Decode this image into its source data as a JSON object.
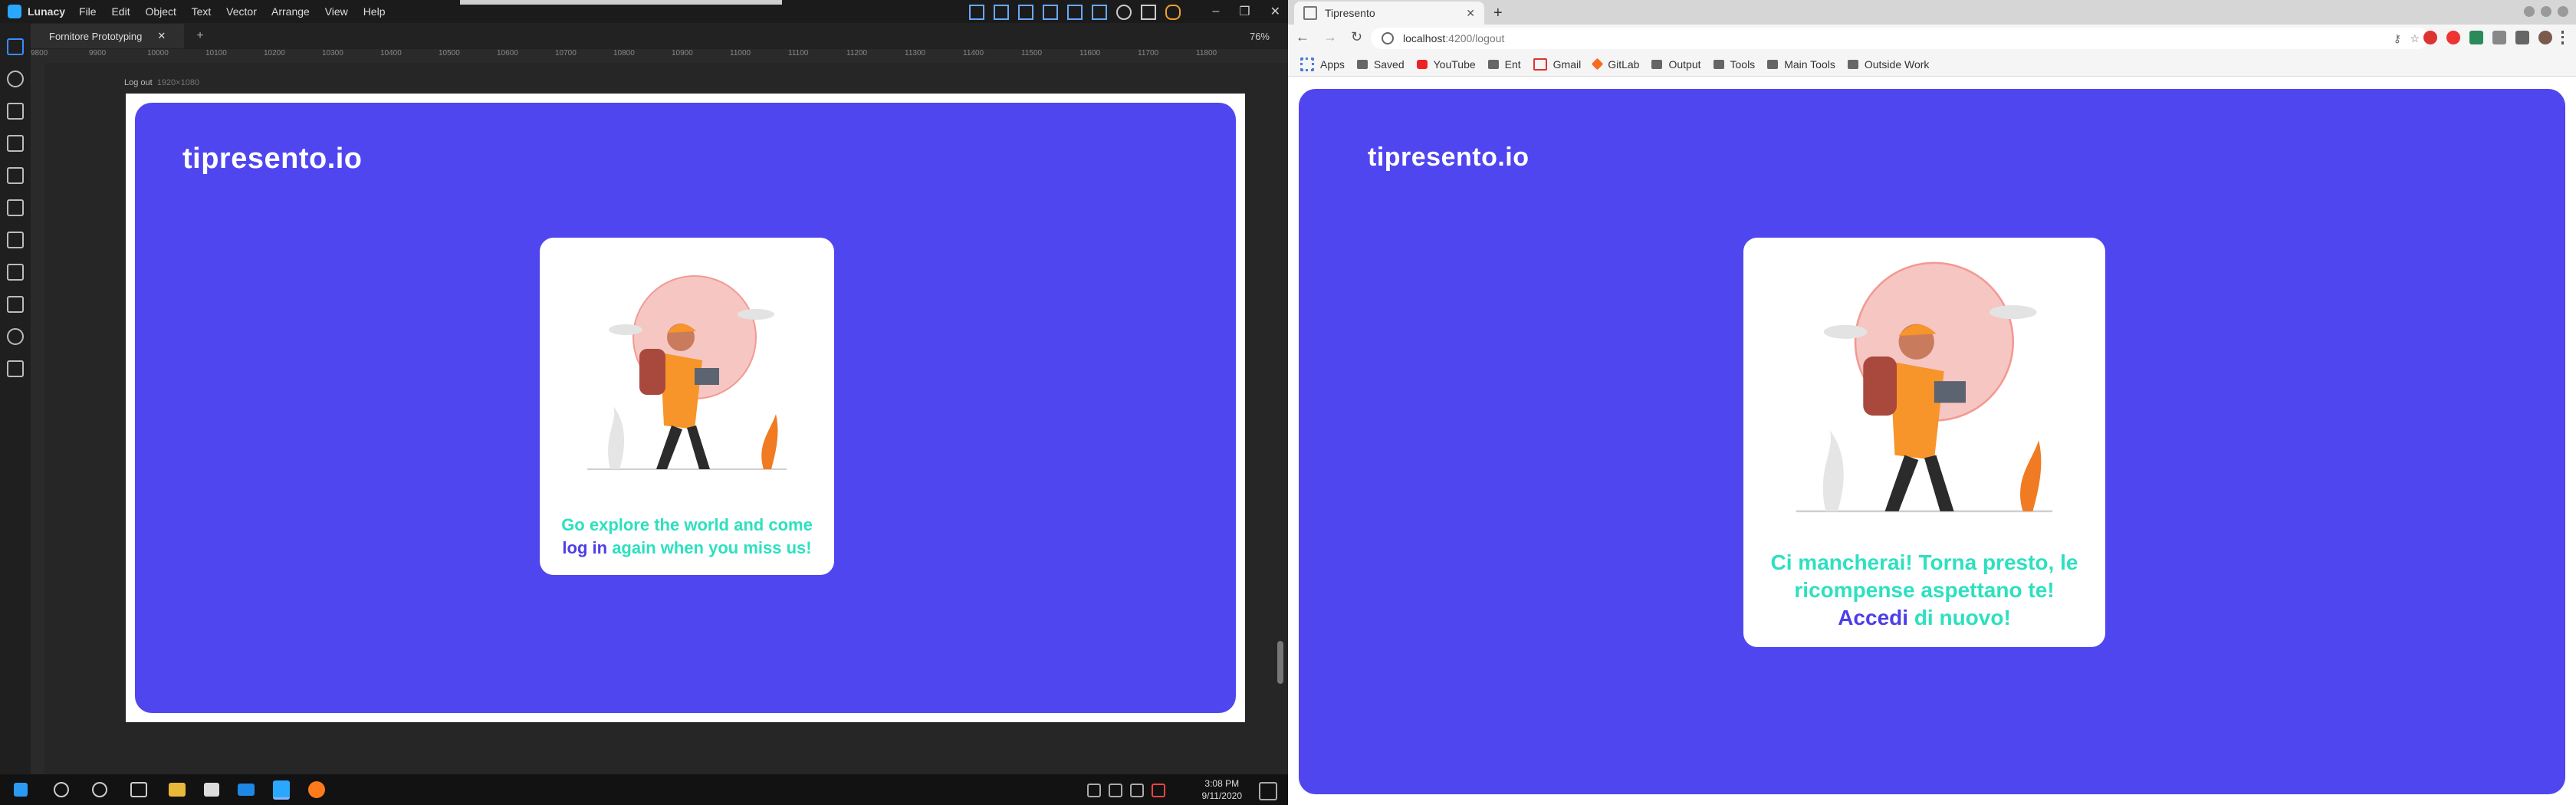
{
  "lunacy": {
    "app_name": "Lunacy",
    "menu": [
      "File",
      "Edit",
      "Object",
      "Text",
      "Vector",
      "Arrange",
      "View",
      "Help"
    ],
    "document_tab": "Fornitore Prototyping",
    "zoom": "76%",
    "ruler_ticks": [
      "9800",
      "9900",
      "10000",
      "10100",
      "10200",
      "10300",
      "10400",
      "10500",
      "10600",
      "10700",
      "10800",
      "10900",
      "11000",
      "11100",
      "11200",
      "11300",
      "11400",
      "11500",
      "11600",
      "11700",
      "11800"
    ],
    "artboard_name": "Log out",
    "artboard_size": "1920×1080",
    "design": {
      "brand": "tipresento.io",
      "message_before": "Go explore the world and come",
      "message_link": "log in",
      "message_after": "again when you miss us!"
    }
  },
  "taskbar": {
    "time": "3:08 PM",
    "date": "9/11/2020"
  },
  "browser": {
    "tab_title": "Tipresento",
    "url_host": "localhost",
    "url_path": ":4200/logout",
    "bookmarks": [
      "Apps",
      "Saved",
      "YouTube",
      "Ent",
      "Gmail",
      "GitLab",
      "Output",
      "Tools",
      "Main Tools",
      "Outside Work"
    ],
    "page": {
      "brand": "tipresento.io",
      "message_line1": "Ci mancherai! Torna presto, le",
      "message_line2": "ricompense aspettano te!",
      "message_link": "Accedi",
      "message_after": "di nuovo!"
    }
  },
  "colors": {
    "brand_purple": "#5046f0",
    "accent_teal": "#2de0c0",
    "link_purple": "#4c3ee8"
  }
}
